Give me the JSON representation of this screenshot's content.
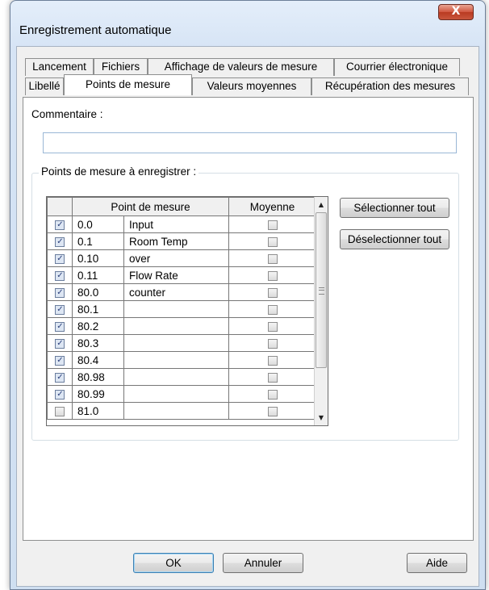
{
  "window": {
    "title": "Enregistrement automatique",
    "close_glyph": "X"
  },
  "tabs": {
    "row_top": [
      "Lancement",
      "Fichiers",
      "Affichage de valeurs de mesure",
      "Courrier électronique"
    ],
    "row_bottom": [
      "Libellé",
      "Points de mesure",
      "Valeurs moyennes",
      "Récupération des mesures"
    ],
    "active": "Points de mesure"
  },
  "comment": {
    "label": "Commentaire :",
    "value": ""
  },
  "group": {
    "label": "Points de mesure à enregistrer :"
  },
  "grid": {
    "headers": {
      "point": "Point de mesure",
      "average": "Moyenne"
    },
    "rows": [
      {
        "checked": true,
        "id": "0.0",
        "name": "Input",
        "average": false
      },
      {
        "checked": true,
        "id": "0.1",
        "name": "Room Temp",
        "average": false
      },
      {
        "checked": true,
        "id": "0.10",
        "name": "over",
        "average": false
      },
      {
        "checked": true,
        "id": "0.11",
        "name": "Flow Rate",
        "average": false
      },
      {
        "checked": true,
        "id": "80.0",
        "name": "counter",
        "average": false
      },
      {
        "checked": true,
        "id": "80.1",
        "name": "",
        "average": false
      },
      {
        "checked": true,
        "id": "80.2",
        "name": "",
        "average": false
      },
      {
        "checked": true,
        "id": "80.3",
        "name": "",
        "average": false
      },
      {
        "checked": true,
        "id": "80.4",
        "name": "",
        "average": false
      },
      {
        "checked": true,
        "id": "80.98",
        "name": "",
        "average": false
      },
      {
        "checked": true,
        "id": "80.99",
        "name": "",
        "average": false
      },
      {
        "checked": false,
        "id": "81.0",
        "name": "",
        "average": false
      }
    ]
  },
  "buttons": {
    "select_all": "Sélectionner tout",
    "deselect_all": "Déselectionner tout",
    "ok": "OK",
    "cancel": "Annuler",
    "help": "Aide"
  }
}
